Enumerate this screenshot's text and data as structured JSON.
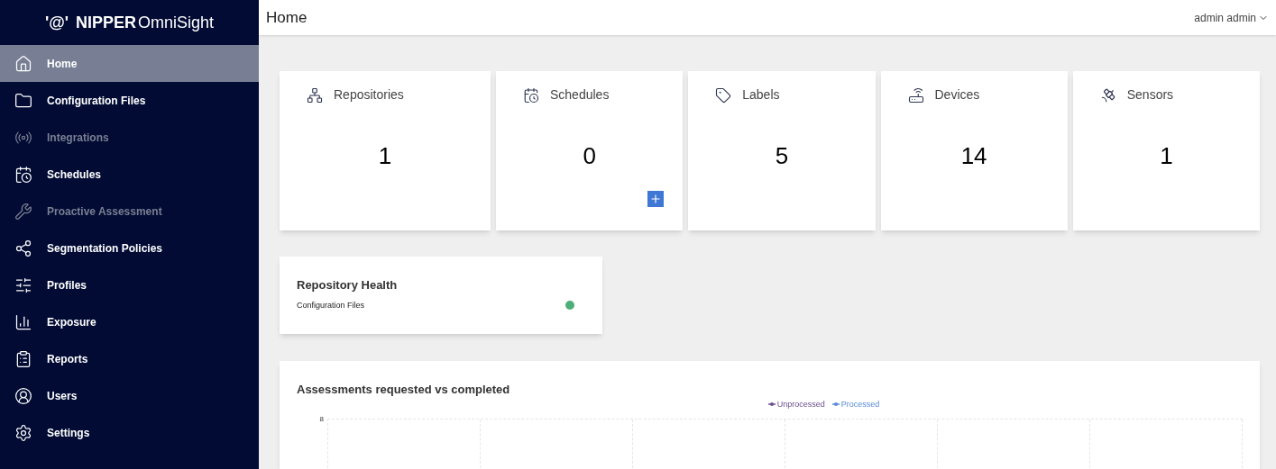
{
  "sidebar": {
    "logo_mark": "'@'",
    "logo_brand": "NIPPER",
    "logo_product": "OmniSight",
    "items": [
      {
        "label": "Home",
        "selected": true,
        "disabled": false
      },
      {
        "label": "Configuration Files",
        "selected": false,
        "disabled": false
      },
      {
        "label": "Integrations",
        "selected": false,
        "disabled": true
      },
      {
        "label": "Schedules",
        "selected": false,
        "disabled": false
      },
      {
        "label": "Proactive Assessment",
        "selected": false,
        "disabled": true
      },
      {
        "label": "Segmentation Policies",
        "selected": false,
        "disabled": false
      },
      {
        "label": "Profiles",
        "selected": false,
        "disabled": false
      },
      {
        "label": "Exposure",
        "selected": false,
        "disabled": false
      },
      {
        "label": "Reports",
        "selected": false,
        "disabled": false
      },
      {
        "label": "Users",
        "selected": false,
        "disabled": false
      },
      {
        "label": "Settings",
        "selected": false,
        "disabled": false
      }
    ]
  },
  "header": {
    "title": "Home",
    "user": "admin admin"
  },
  "stat_cards": [
    {
      "label": "Repositories",
      "value": "1",
      "add_button": false
    },
    {
      "label": "Schedules",
      "value": "0",
      "add_button": true
    },
    {
      "label": "Labels",
      "value": "5",
      "add_button": false
    },
    {
      "label": "Devices",
      "value": "14",
      "add_button": false
    },
    {
      "label": "Sensors",
      "value": "1",
      "add_button": false
    }
  ],
  "repository_health": {
    "title": "Repository Health",
    "items": [
      {
        "label": "Configuration Files",
        "color": "#4caf78"
      }
    ]
  },
  "assessments_chart": {
    "title": "Assessments requested vs completed",
    "legend": [
      {
        "name": "Unprocessed",
        "color": "#6b4f8f"
      },
      {
        "name": "Processed",
        "color": "#5b8bd6"
      }
    ],
    "ytick_labels": [
      "8"
    ]
  }
}
